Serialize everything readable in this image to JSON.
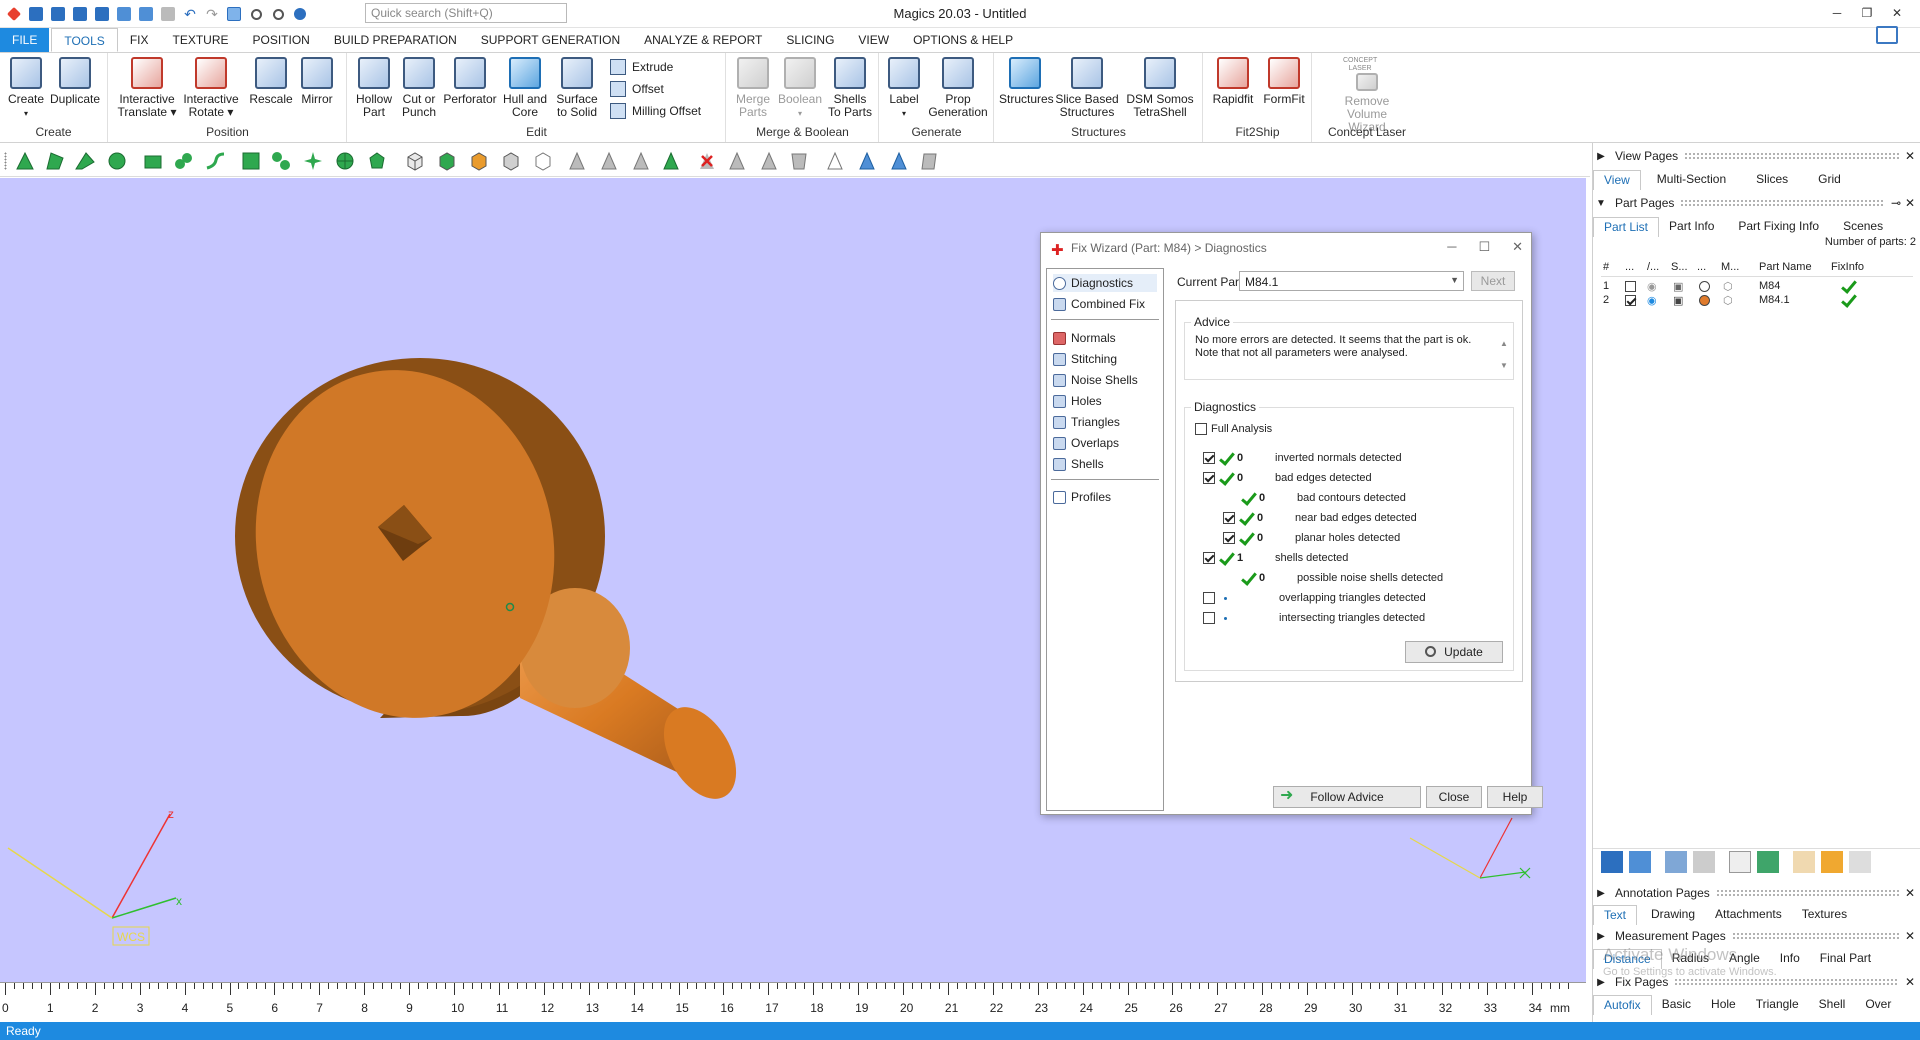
{
  "app": {
    "title": "Magics 20.03 - Untitled",
    "search_placeholder": "Quick search (Shift+Q)",
    "window_controls": [
      "─",
      "❐",
      "✕"
    ]
  },
  "menu": {
    "tabs": [
      "FILE",
      "TOOLS",
      "FIX",
      "TEXTURE",
      "POSITION",
      "BUILD PREPARATION",
      "SUPPORT GENERATION",
      "ANALYZE & REPORT",
      "SLICING",
      "VIEW",
      "OPTIONS & HELP"
    ],
    "active": "TOOLS"
  },
  "ribbon": {
    "create": {
      "label": "Create",
      "b1": "Create",
      "b2": "Duplicate"
    },
    "position": {
      "label": "Position",
      "b1a": "Interactive",
      "b1b": "Translate",
      "b2a": "Interactive",
      "b2b": "Rotate",
      "b3": "Rescale",
      "b4": "Mirror"
    },
    "edit": {
      "label": "Edit",
      "b1a": "Hollow",
      "b1b": "Part",
      "b2a": "Cut or",
      "b2b": "Punch",
      "b3": "Perforator",
      "b4a": "Hull and",
      "b4b": "Core",
      "b5a": "Surface",
      "b5b": "to Solid",
      "s1": "Extrude",
      "s2": "Offset",
      "s3": "Milling Offset"
    },
    "merge": {
      "label": "Merge & Boolean",
      "b1a": "Merge",
      "b1b": "Parts",
      "b2": "Boolean",
      "b3a": "Shells",
      "b3b": "To Parts"
    },
    "generate": {
      "label": "Generate",
      "b1": "Label",
      "b2a": "Prop",
      "b2b": "Generation"
    },
    "structures": {
      "label": "Structures",
      "b1": "Structures",
      "b2a": "Slice Based",
      "b2b": "Structures",
      "b3a": "DSM Somos",
      "b3b": "TetraShell"
    },
    "fit2ship": {
      "label": "Fit2Ship",
      "b1": "Rapidfit",
      "b2": "FormFit"
    },
    "concept": {
      "label": "Concept Laser",
      "logo1": "CONCEPT",
      "logo2": "LASER",
      "b1a": "Remove Volume",
      "b1b": "Wizard"
    }
  },
  "viewport": {
    "background": "#c6c6ff",
    "part_color": "#d97a22",
    "wcs_label": "WCS",
    "axis_z": "z",
    "axis_x": "x"
  },
  "ruler": {
    "unit": "mm",
    "labels": [
      "0",
      "1",
      "2",
      "3",
      "4",
      "5",
      "6",
      "7",
      "8",
      "9",
      "10",
      "11",
      "12",
      "13",
      "14",
      "15",
      "16",
      "17",
      "18",
      "19",
      "20",
      "21",
      "22",
      "23",
      "24",
      "25",
      "26",
      "27",
      "28",
      "29",
      "30",
      "31",
      "32",
      "33",
      "34"
    ]
  },
  "status": {
    "text": "Ready"
  },
  "dialog": {
    "title": "Fix Wizard (Part: M84) > Diagnostics",
    "nav": {
      "diagnostics": "Diagnostics",
      "combined_fix": "Combined Fix",
      "normals": "Normals",
      "stitching": "Stitching",
      "noise_shells": "Noise Shells",
      "holes": "Holes",
      "triangles": "Triangles",
      "overlaps": "Overlaps",
      "shells": "Shells",
      "profiles": "Profiles"
    },
    "current_part_label": "Current Part:",
    "current_part_value": "M84.1",
    "next_button": "Next",
    "advice_label": "Advice",
    "advice_text": "No more errors are detected. It seems that the part is ok. Note that not all parameters were analysed.",
    "diagnostics_label": "Diagnostics",
    "full_analysis": "Full Analysis",
    "rows": [
      {
        "count": "0",
        "label": "inverted normals detected"
      },
      {
        "count": "0",
        "label": "bad edges detected"
      },
      {
        "count": "0",
        "label": "bad contours detected"
      },
      {
        "count": "0",
        "label": "near bad edges detected"
      },
      {
        "count": "0",
        "label": "planar holes detected"
      },
      {
        "count": "1",
        "label": "shells detected"
      },
      {
        "count": "0",
        "label": "possible noise shells detected"
      },
      {
        "count": "",
        "label": "overlapping triangles detected"
      },
      {
        "count": "",
        "label": "intersecting triangles detected"
      }
    ],
    "update_button": "Update",
    "follow_advice": "Follow Advice",
    "close": "Close",
    "help": "Help"
  },
  "panel": {
    "view_pages": "View Pages",
    "view_tabs": [
      "View",
      "Multi-Section",
      "Slices",
      "Grid"
    ],
    "part_pages": "Part Pages",
    "part_tabs": [
      "Part List",
      "Part Info",
      "Part Fixing Info",
      "Scenes"
    ],
    "num_parts": "Number of parts: 2",
    "col_headers": [
      "#",
      "...",
      "/...",
      "S...",
      "...",
      "M...",
      "Part Name",
      "FixInfo"
    ],
    "parts": [
      {
        "num": "1",
        "name": "M84",
        "dot": "#ffffff"
      },
      {
        "num": "2",
        "name": "M84.1",
        "dot": "#e07b2c"
      }
    ],
    "annotation_pages": "Annotation Pages",
    "annotation_tabs": [
      "Text",
      "Drawing",
      "Attachments",
      "Textures"
    ],
    "measurement_pages": "Measurement Pages",
    "measurement_tabs": [
      "Distance",
      "Radius",
      "Angle",
      "Info",
      "Final Part"
    ],
    "fix_pages": "Fix Pages",
    "fix_tabs": [
      "Autofix",
      "Basic",
      "Hole",
      "Triangle",
      "Shell",
      "Over"
    ],
    "watermark1": "Activate Windows",
    "watermark2": "Go to Settings to activate Windows."
  }
}
